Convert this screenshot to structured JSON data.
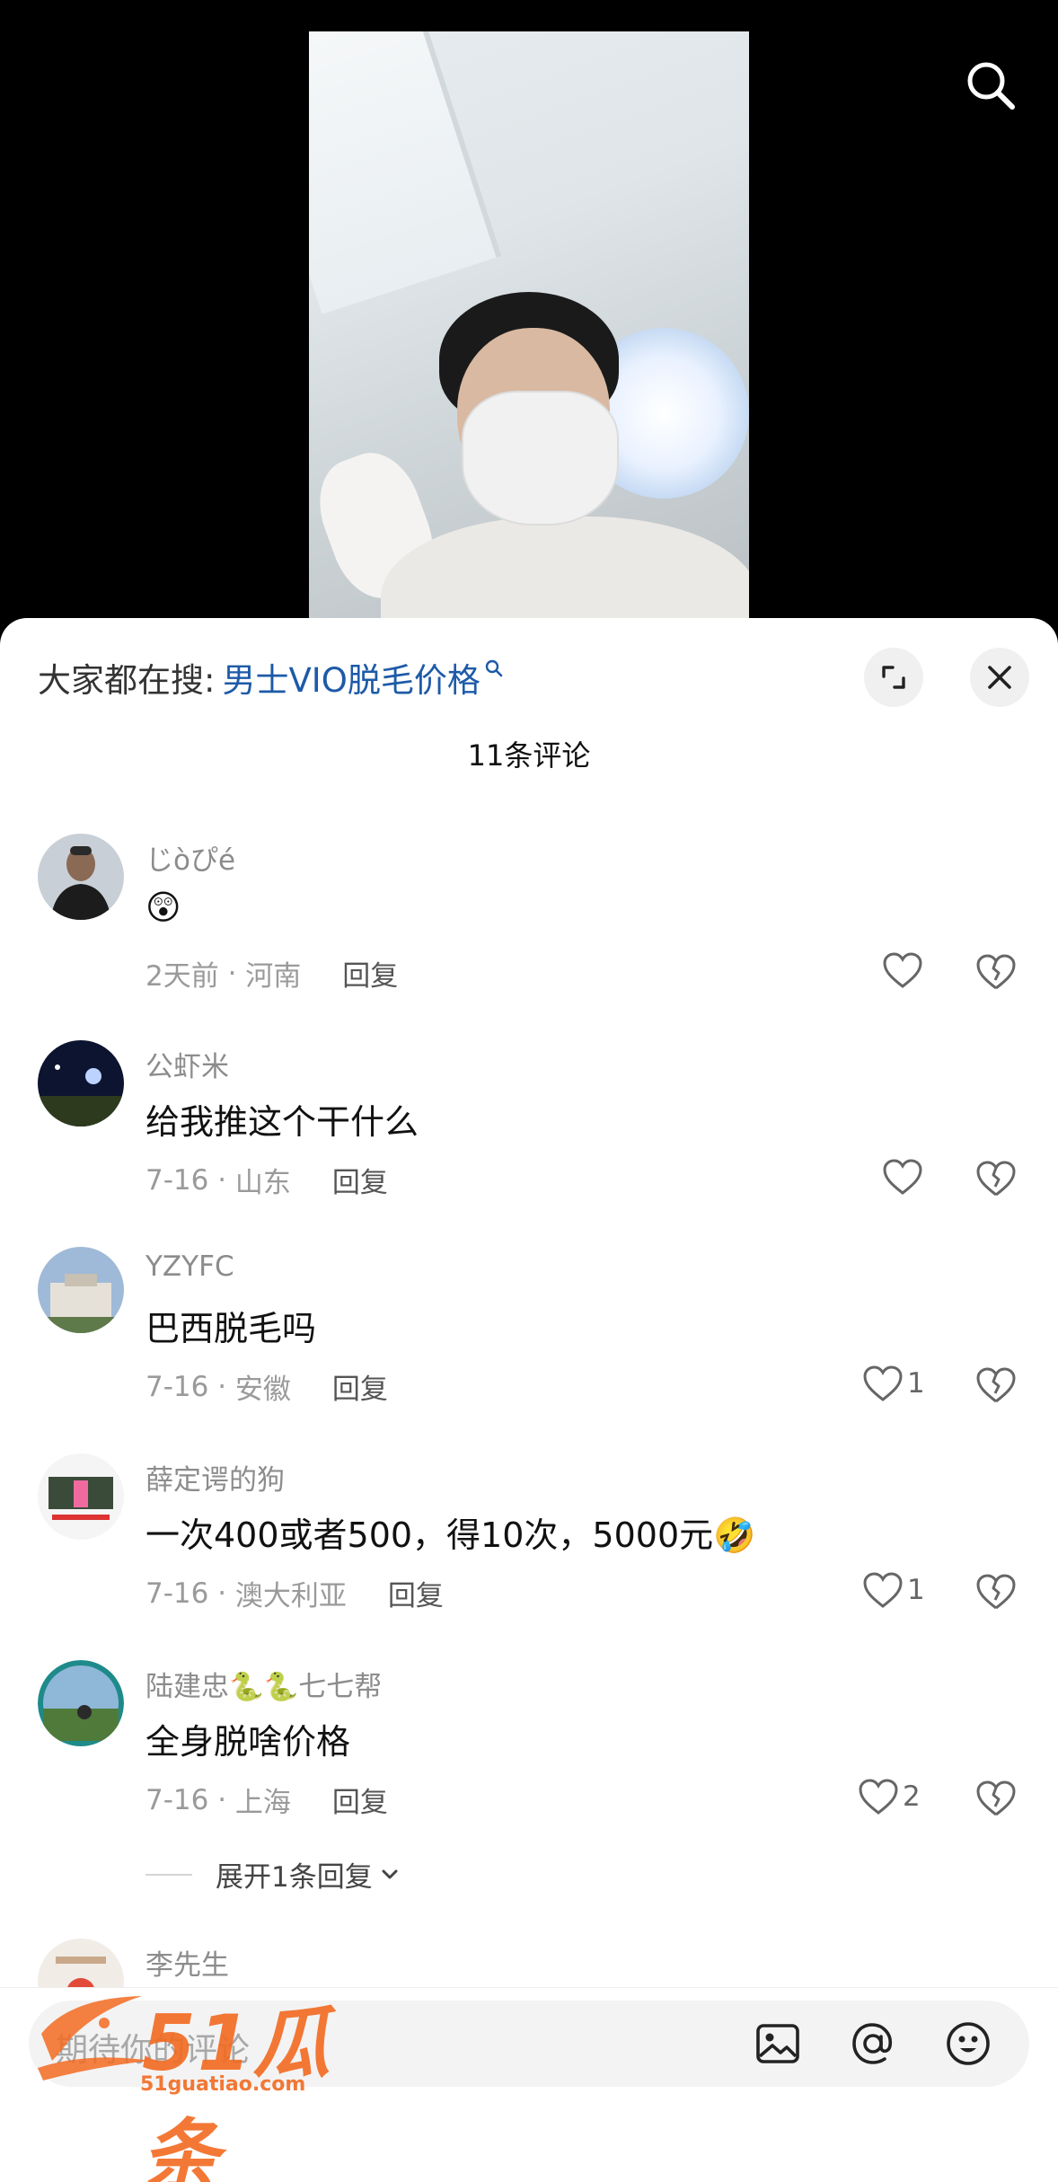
{
  "video": {
    "search_icon": "search-icon"
  },
  "sheet": {
    "suggest_prefix": "大家都在搜:",
    "suggest_link": "男士VIO脱毛价格",
    "comment_count": "11条评论"
  },
  "comments": [
    {
      "user": "じòぴé",
      "text": "😲",
      "time": "2天前",
      "location": "河南",
      "reply": "回复",
      "likes": ""
    },
    {
      "user": "公虾米",
      "text": "给我推这个干什么",
      "time": "7-16",
      "location": "山东",
      "reply": "回复",
      "likes": ""
    },
    {
      "user": "YZYFC",
      "text": "巴西脱毛吗",
      "time": "7-16",
      "location": "安徽",
      "reply": "回复",
      "likes": "1"
    },
    {
      "user": "薛定谔的狗",
      "text": "一次400或者500，得10次，5000元🤣",
      "time": "7-16",
      "location": "澳大利亚",
      "reply": "回复",
      "likes": "1"
    },
    {
      "user": "陆建忠🐍🐍七七帮",
      "text": "全身脱啥价格",
      "time": "7-16",
      "location": "上海",
      "reply": "回复",
      "likes": "2"
    },
    {
      "user": "李先生",
      "text": "",
      "time": "",
      "location": "",
      "reply": "",
      "likes": ""
    }
  ],
  "expand_replies": "展开1条回复",
  "input": {
    "placeholder": "期待你的评论"
  },
  "watermark": {
    "brand": "51瓜条",
    "url": "51guatiao.com"
  },
  "colors": {
    "link": "#1d5aa8",
    "watermark": "#f26a21"
  }
}
